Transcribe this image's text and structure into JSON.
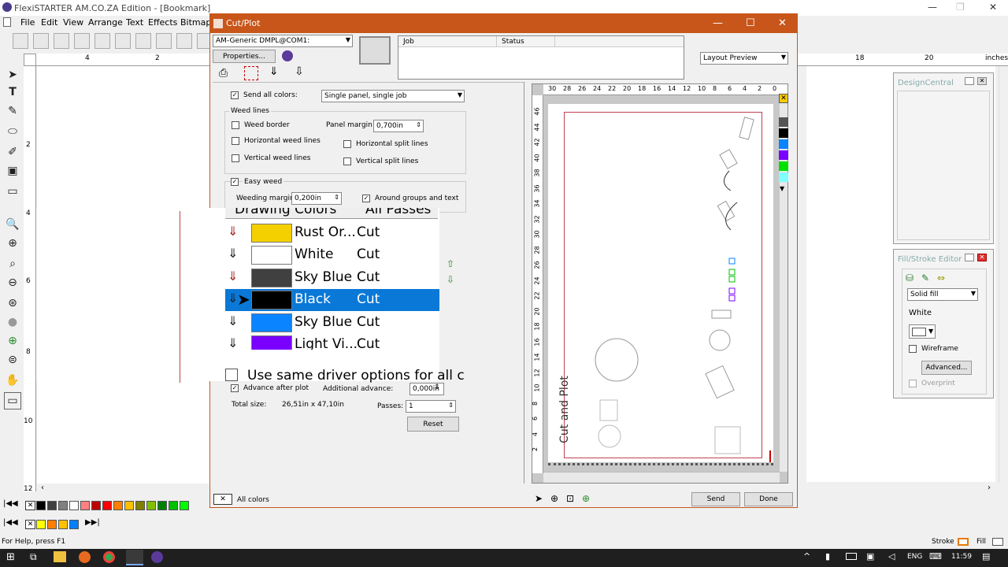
{
  "app": {
    "title": "FlexiSTARTER AM.CO.ZA Edition - [Bookmark]",
    "menus": [
      "File",
      "Edit",
      "View",
      "Arrange",
      "Text",
      "Effects",
      "Bitmap"
    ],
    "ruler_labels": [
      "4",
      "2"
    ],
    "right_ruler_labels": [
      "18",
      "20",
      "inches"
    ],
    "vruler_labels": [
      "4",
      "2",
      "6",
      "8",
      "10",
      "12"
    ]
  },
  "dialog": {
    "title": "Cut/Plot",
    "device": "AM-Generic DMPL@COM1:",
    "properties_label": "Properties...",
    "job_header": "Job",
    "status_header": "Status",
    "preview_mode": "Layout Preview",
    "send_all_colors": "Send all colors:",
    "panel_mode": "Single panel, single job",
    "weed_lines_title": "Weed lines",
    "weed_border": "Weed border",
    "panel_margin_label": "Panel margin:",
    "panel_margin_value": "0,700in",
    "horizontal_weed": "Horizontal weed lines",
    "horizontal_split": "Horizontal split lines",
    "vertical_weed": "Vertical weed lines",
    "vertical_split": "Vertical split lines",
    "easy_weed": "Easy weed",
    "weeding_margin_label": "Weeding margin:",
    "weeding_margin_value": "0,200in",
    "around_groups": "Around groups and text",
    "drawing_colors_header": "Drawing Colors",
    "all_passes_header": "All Passes",
    "colors": [
      {
        "name": "Rust Or...",
        "mode": "Cut",
        "swatch": "#f5d000"
      },
      {
        "name": "White",
        "mode": "Cut",
        "swatch": "#ffffff"
      },
      {
        "name": "Sky Blue",
        "mode": "Cut",
        "swatch": "#404040"
      },
      {
        "name": "Black",
        "mode": "Cut",
        "swatch": "#000000"
      },
      {
        "name": "Sky Blue",
        "mode": "Cut",
        "swatch": "#0a84ff"
      },
      {
        "name": "Light Vi...",
        "mode": "Cut",
        "swatch": "#7a00ff"
      }
    ],
    "use_same_driver": "Use same driver options for all c",
    "advance_after_plot": "Advance after plot",
    "additional_advance_label": "Additional advance:",
    "additional_advance_value": "0,000in",
    "total_size_label": "Total size:",
    "total_size_value": "26,51in x 47,10in",
    "passes_label": "Passes:",
    "passes_value": "1",
    "reset_label": "Reset",
    "all_colors_label": "All colors",
    "send_label": "Send",
    "done_label": "Done",
    "preview_text": "Cut and Plot",
    "hruler": [
      "30",
      "28",
      "26",
      "24",
      "22",
      "20",
      "18",
      "16",
      "14",
      "12",
      "10",
      "8",
      "6",
      "4",
      "2",
      "0"
    ],
    "vruler": [
      "46",
      "44",
      "42",
      "40",
      "38",
      "36",
      "34",
      "32",
      "30",
      "28",
      "26",
      "24",
      "22",
      "20",
      "18",
      "16",
      "14",
      "12",
      "10",
      "8",
      "6",
      "4",
      "2"
    ]
  },
  "design_central": {
    "title": "DesignCentral"
  },
  "fill_stroke": {
    "title": "Fill/Stroke Editor",
    "fill_type": "Solid fill",
    "color_name": "White",
    "wireframe": "Wireframe",
    "advanced": "Advanced...",
    "overprint": "Overprint"
  },
  "status": {
    "help": "For Help, press F1",
    "stroke": "Stroke",
    "fill": "Fill"
  },
  "taskbar": {
    "lang": "ENG",
    "time": "11:59"
  },
  "palette": [
    "#000000",
    "#404040",
    "#808080",
    "#ffffff",
    "#ff8080",
    "#c00000",
    "#ff0000",
    "#ff8000",
    "#ffc000",
    "#808000",
    "#80c000",
    "#008000",
    "#00c000",
    "#00ff00"
  ],
  "palette2": [
    "#ffff00",
    "#ff8000",
    "#ffc000",
    "#0080ff"
  ]
}
